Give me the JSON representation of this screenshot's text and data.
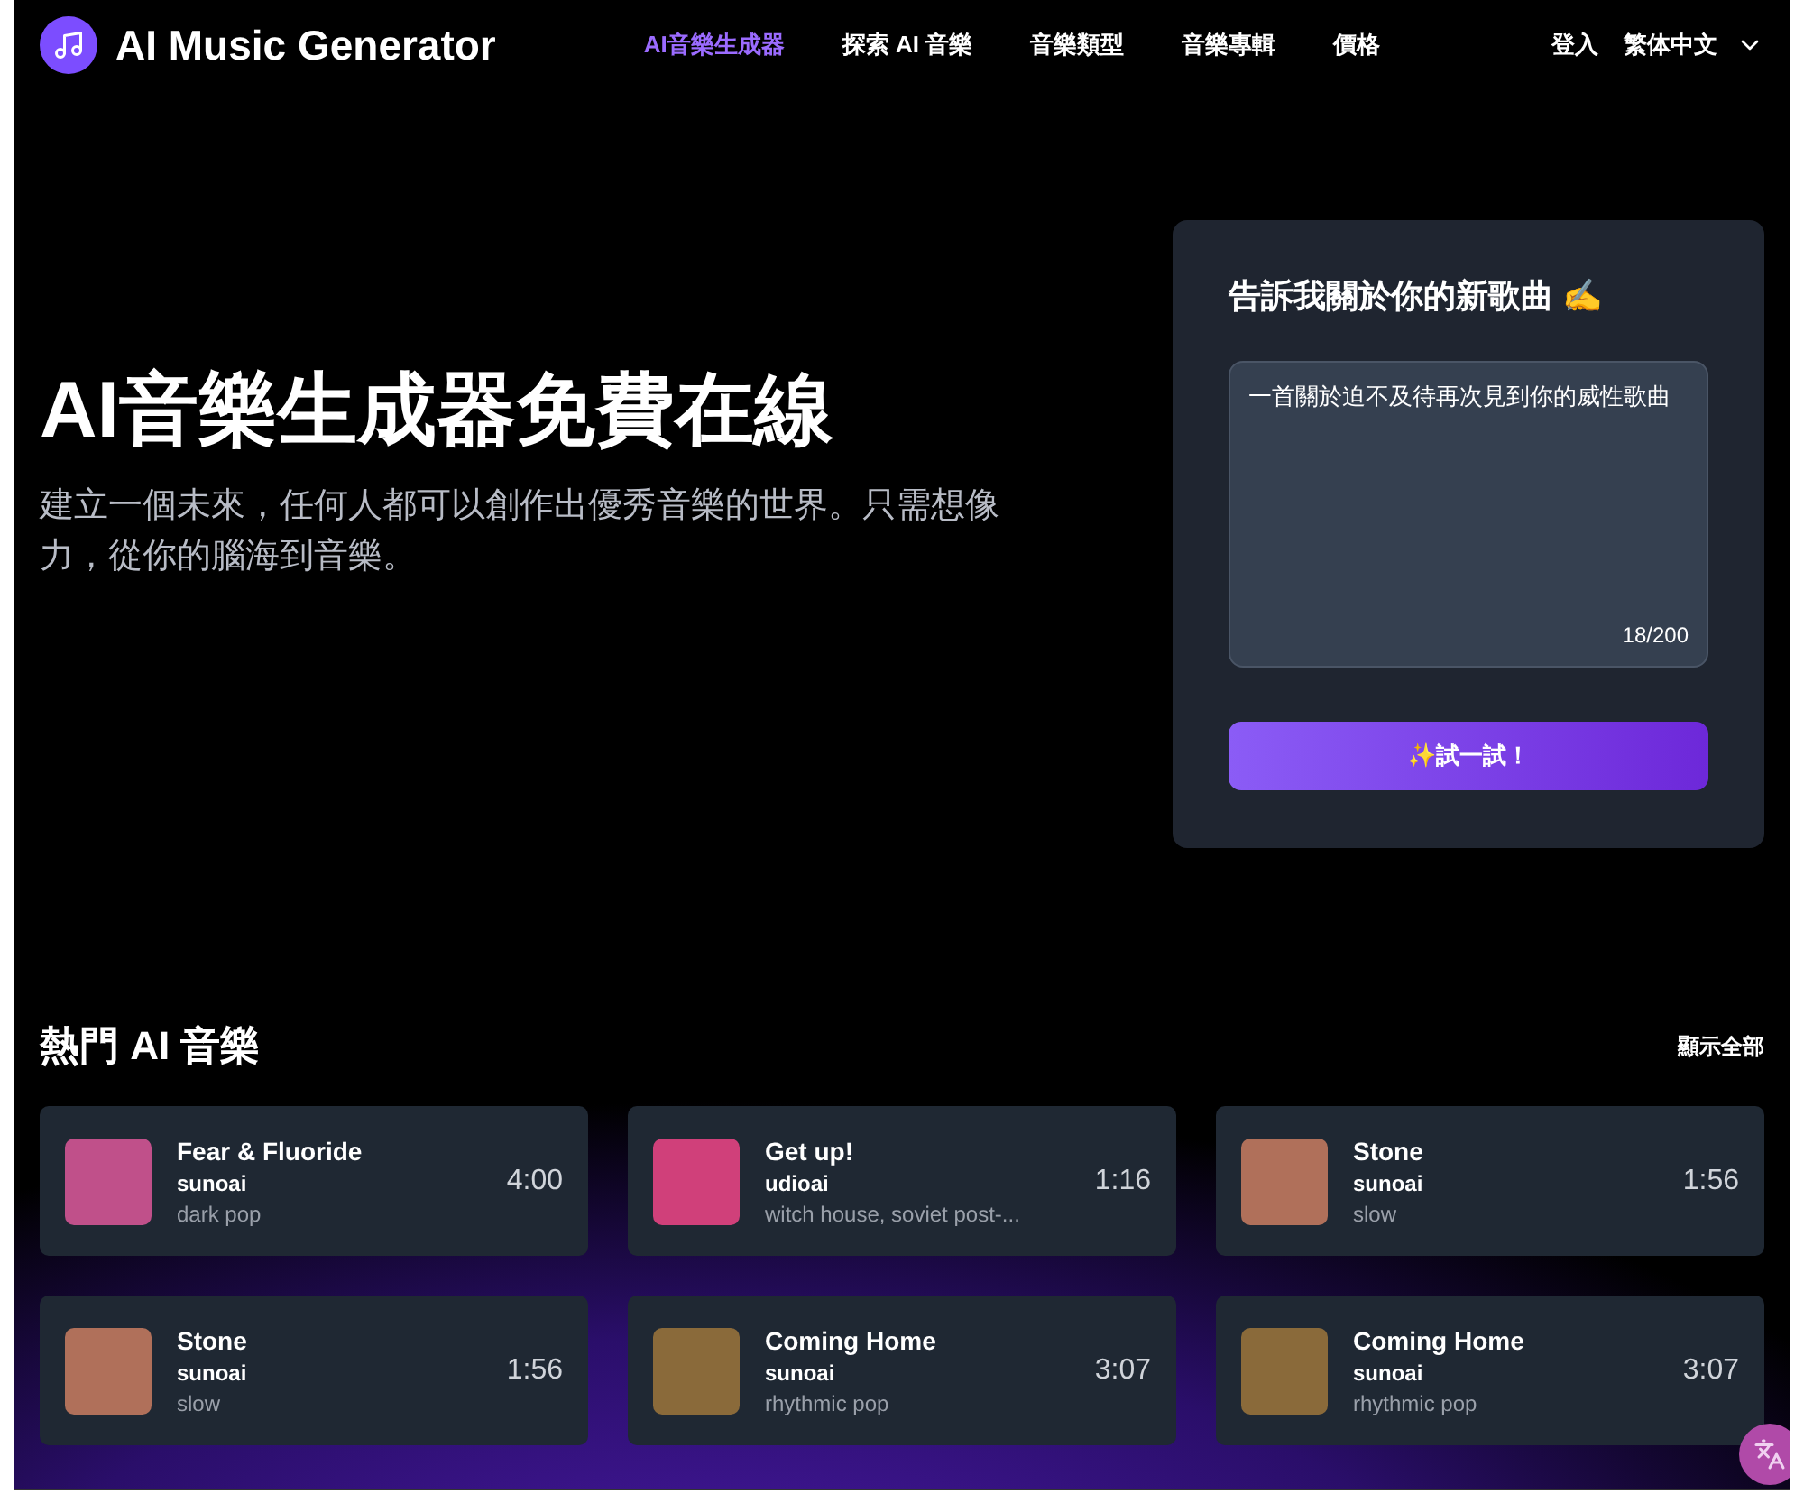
{
  "header": {
    "logo": "AI Music Generator",
    "nav": [
      {
        "label": "AI音樂生成器",
        "selected": true
      },
      {
        "label": "探索 AI 音樂",
        "selected": false
      },
      {
        "label": "音樂類型",
        "selected": false
      },
      {
        "label": "音樂專輯",
        "selected": false
      },
      {
        "label": "價格",
        "selected": false
      }
    ],
    "login": "登入",
    "language": "繁体中文"
  },
  "hero": {
    "title": "AI音樂生成器免費在線",
    "subtitle": "建立一個未來，任何人都可以創作出優秀音樂的世界。只需想像力，從你的腦海到音樂。"
  },
  "composer": {
    "title": "告訴我關於你的新歌曲 ✍️",
    "value": "一首關於迫不及待再次見到你的威性歌曲",
    "counter": "18/200",
    "button": "✨試一試！"
  },
  "trending": {
    "title": "熱門 AI 音樂",
    "show_all": "顯示全部",
    "songs": [
      {
        "title": "Fear & Fluoride",
        "artist": "sunoai",
        "genre": "dark pop",
        "duration": "4:00",
        "color": "#c0508a"
      },
      {
        "title": "Get up!",
        "artist": "udioai",
        "genre": "witch house, soviet post-...",
        "duration": "1:16",
        "color": "#d0407a"
      },
      {
        "title": "Stone",
        "artist": "sunoai",
        "genre": "slow",
        "duration": "1:56",
        "color": "#b0705a"
      },
      {
        "title": "Stone",
        "artist": "sunoai",
        "genre": "slow",
        "duration": "1:56",
        "color": "#b0705a"
      },
      {
        "title": "Coming Home",
        "artist": "sunoai",
        "genre": "rhythmic pop",
        "duration": "3:07",
        "color": "#8a6a3a"
      },
      {
        "title": "Coming Home",
        "artist": "sunoai",
        "genre": "rhythmic pop",
        "duration": "3:07",
        "color": "#8a6a3a"
      }
    ]
  }
}
